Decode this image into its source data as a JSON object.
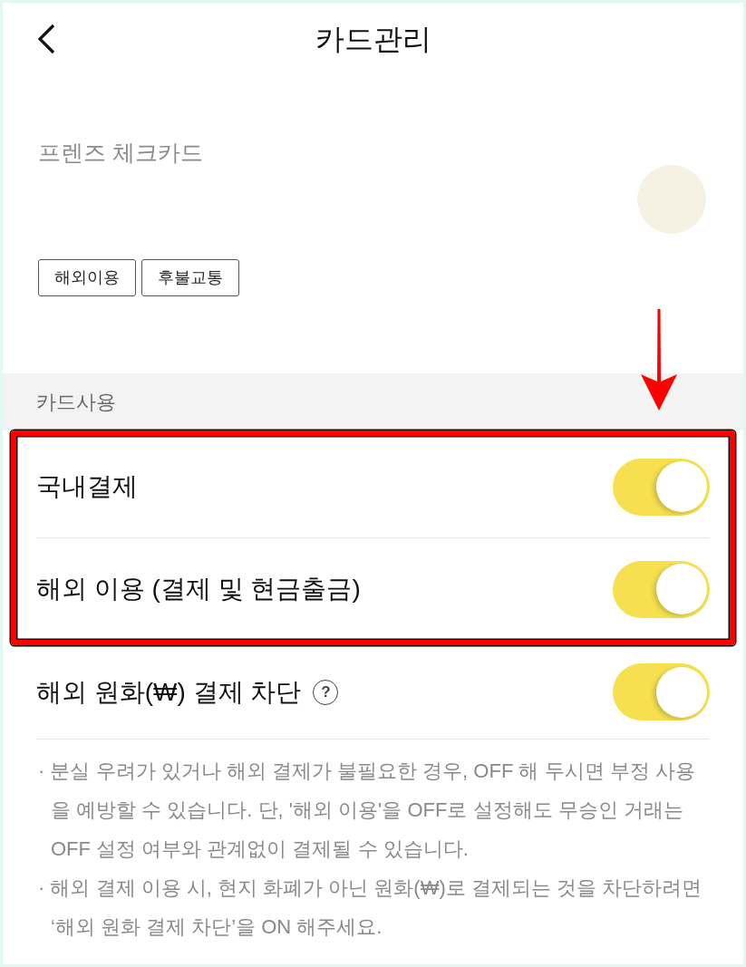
{
  "header": {
    "title": "카드관리"
  },
  "card": {
    "name": "프렌즈 체크카드",
    "tags": [
      "해외이용",
      "후불교통"
    ]
  },
  "section": {
    "title": "카드사용"
  },
  "rows": [
    {
      "label": "국내결제",
      "on": true,
      "highlighted": true
    },
    {
      "label": "해외 이용 (결제 및 현금출금)",
      "on": true,
      "highlighted": true
    },
    {
      "label": "해외 원화(₩) 결제 차단",
      "help": "?",
      "on": true,
      "highlighted": false
    }
  ],
  "notes": [
    "· 분실 우려가 있거나 해외 결제가 불필요한 경우, OFF 해 두시면 부정 사용을 예방할 수 있습니다. 단, '해외 이용'을 OFF로 설정해도 무승인 거래는 OFF 설정 여부와 관계없이 결제될 수 있습니다.",
    "· 해외 결제 이용 시, 현지 화폐가 아닌 원화(₩)로 결제되는 것을 차단하려면 ‘해외 원화 결제 차단’을 ON 해주세요."
  ]
}
